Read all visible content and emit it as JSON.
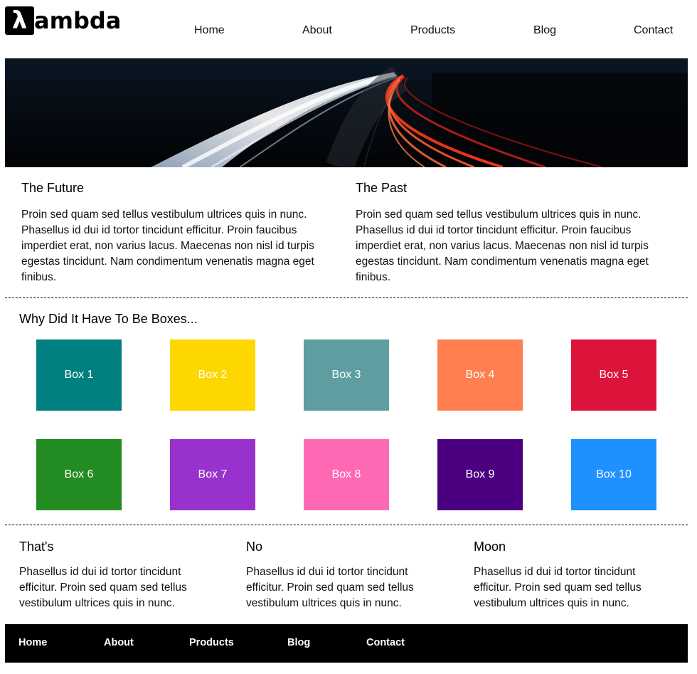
{
  "header": {
    "logo_mark": "λ",
    "logo_text": "ambda",
    "nav": [
      "Home",
      "About",
      "Products",
      "Blog",
      "Contact"
    ]
  },
  "intro": [
    {
      "title": "The Future",
      "text": "Proin sed quam sed tellus vestibulum ultrices quis in nunc. Phasellus id dui id tortor tincidunt efficitur. Proin faucibus imperdiet erat, non varius lacus. Maecenas non nisl id turpis egestas tincidunt. Nam condimentum venenatis magna eget finibus."
    },
    {
      "title": "The Past",
      "text": "Proin sed quam sed tellus vestibulum ultrices quis in nunc. Phasellus id dui id tortor tincidunt efficitur. Proin faucibus imperdiet erat, non varius lacus. Maecenas non nisl id turpis egestas tincidunt. Nam condimentum venenatis magna eget finibus."
    }
  ],
  "boxes_section": {
    "title": "Why Did It Have To Be Boxes...",
    "boxes": [
      {
        "label": "Box 1",
        "color": "#008080"
      },
      {
        "label": "Box 2",
        "color": "#FFD700"
      },
      {
        "label": "Box 3",
        "color": "#5F9EA0"
      },
      {
        "label": "Box 4",
        "color": "#FF7F50"
      },
      {
        "label": "Box 5",
        "color": "#DC143C"
      },
      {
        "label": "Box 6",
        "color": "#228B22"
      },
      {
        "label": "Box 7",
        "color": "#9932CC"
      },
      {
        "label": "Box 8",
        "color": "#FF69B4"
      },
      {
        "label": "Box 9",
        "color": "#4B0082"
      },
      {
        "label": "Box 10",
        "color": "#1E90FF"
      }
    ]
  },
  "bottom": [
    {
      "title": "That's",
      "text": "Phasellus id dui id tortor tincidunt efficitur. Proin sed quam sed tellus vestibulum ultrices quis in nunc."
    },
    {
      "title": "No",
      "text": "Phasellus id dui id tortor tincidunt efficitur. Proin sed quam sed tellus vestibulum ultrices quis in nunc."
    },
    {
      "title": "Moon",
      "text": "Phasellus id dui id tortor tincidunt efficitur. Proin sed quam sed tellus vestibulum ultrices quis in nunc."
    }
  ],
  "footer": {
    "nav": [
      "Home",
      "About",
      "Products",
      "Blog",
      "Contact"
    ]
  }
}
